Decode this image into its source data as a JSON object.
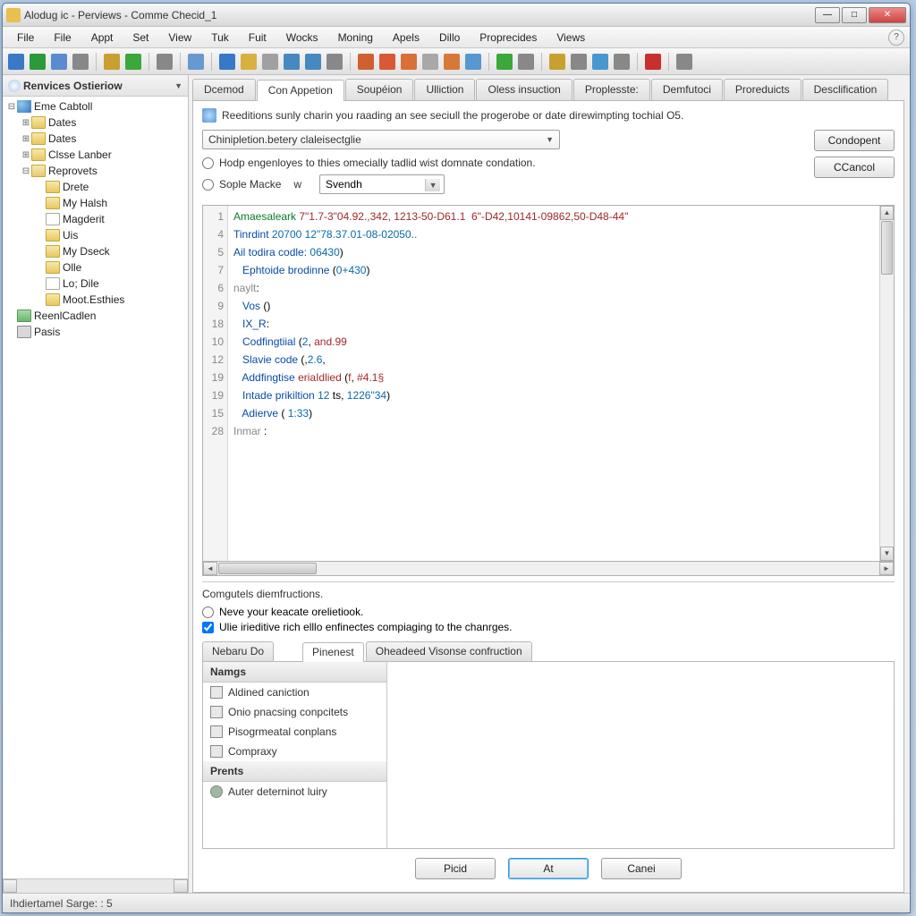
{
  "window": {
    "title": "Alodug ic - Perviews - Comme Checid_1"
  },
  "menus": [
    "File",
    "File",
    "Appt",
    "Set",
    "View",
    "Tuk",
    "Fuit",
    "Wocks",
    "Moning",
    "Apels",
    "Dillo",
    "Proprecides",
    "Views"
  ],
  "toolbar_colors": [
    "#3a78c8",
    "#2a9a3a",
    "#5a8ad0",
    "#888888",
    "",
    "#c8a030",
    "#3aa83a",
    "",
    "#888888",
    "",
    "#6898d0",
    "",
    "#3878c8",
    "#d8b040",
    "#a0a0a0",
    "#4888c0",
    "#4888c0",
    "#888888",
    "",
    "#d06030",
    "#d85838",
    "#d87038",
    "#a8a8a8",
    "#d87838",
    "#5898d0",
    "",
    "#3aa83a",
    "#888888",
    "",
    "#c8a030",
    "#888888",
    "#4898d0",
    "#888888",
    "",
    "#c83030",
    "",
    "#888888"
  ],
  "sidebar": {
    "title": "Renvices Ostieriow",
    "tree": [
      {
        "depth": 0,
        "tw": "⊟",
        "icon": "ic-globe",
        "label": "Eme Cabtoll"
      },
      {
        "depth": 1,
        "tw": "⊞",
        "icon": "ic-folder",
        "label": "Dates"
      },
      {
        "depth": 1,
        "tw": "⊞",
        "icon": "ic-folder",
        "label": "Dates"
      },
      {
        "depth": 1,
        "tw": "⊞",
        "icon": "ic-folder",
        "label": "Clsse Lanber"
      },
      {
        "depth": 1,
        "tw": "⊟",
        "icon": "ic-folder-open",
        "label": "Reprovets"
      },
      {
        "depth": 2,
        "tw": "",
        "icon": "ic-folder",
        "label": "Drete"
      },
      {
        "depth": 2,
        "tw": "",
        "icon": "ic-folder",
        "label": "My Halsh"
      },
      {
        "depth": 2,
        "tw": "",
        "icon": "ic-page",
        "label": "Magderit"
      },
      {
        "depth": 2,
        "tw": "",
        "icon": "ic-folder",
        "label": "Uis"
      },
      {
        "depth": 2,
        "tw": "",
        "icon": "ic-folder",
        "label": "My Dseck"
      },
      {
        "depth": 2,
        "tw": "",
        "icon": "ic-folder",
        "label": "Olle"
      },
      {
        "depth": 2,
        "tw": "",
        "icon": "ic-page",
        "label": "Lo; Dile"
      },
      {
        "depth": 2,
        "tw": "",
        "icon": "ic-folder",
        "label": "Moot.Esthies"
      },
      {
        "depth": 0,
        "tw": "",
        "icon": "ic-chart",
        "label": "ReenlCadlen"
      },
      {
        "depth": 0,
        "tw": "",
        "icon": "ic-gear",
        "label": "Pasis"
      }
    ]
  },
  "tabs": [
    "Dcemod",
    "Con Appetion",
    "Soupéion",
    "Ulliction",
    "Oless insuction",
    "Proplesste:",
    "Demfutoci",
    "Proreduicts",
    "Desclification"
  ],
  "active_tab": 1,
  "desc": "Reeditions sunly charin you raading an see seciull the progerobe or date direwimpting tochial O5.",
  "combo": "Chinipletion.betery claleisectglie",
  "radio1": "Hodp engenloyes to thies omecially tadlid wist domnate condation.",
  "radio2": "Sople Macke",
  "w_label": "w",
  "miniselect": "Svendh",
  "btn_condepent": "Condopent",
  "btn_cancel": "CCancol",
  "code": {
    "line_numbers": [
      "1",
      "4",
      "5",
      "7",
      "6",
      "9",
      "18",
      "10",
      "12",
      "19",
      "19",
      "15",
      "28"
    ],
    "lines": [
      [
        {
          "c": "tok-k",
          "t": "Amaesaleark"
        },
        {
          "c": "",
          "t": " "
        },
        {
          "c": "tok-r",
          "t": "7\"1.7-3\"04.92.,342, 1213-50-D61.1  6\"-D42,10141-09862,50-D48-44\""
        }
      ],
      [
        {
          "c": "tok-b",
          "t": "Tinrdint"
        },
        {
          "c": "",
          "t": " "
        },
        {
          "c": "tok-n",
          "t": "20700 12\"78.37.01-08-02050.."
        }
      ],
      [
        {
          "c": "tok-b",
          "t": "Ail todira codle:"
        },
        {
          "c": "",
          "t": " "
        },
        {
          "c": "tok-n",
          "t": "06430"
        },
        {
          "c": "",
          "t": ")"
        }
      ],
      [
        {
          "c": "",
          "t": "   "
        },
        {
          "c": "tok-b",
          "t": "Ephtoide brodinne"
        },
        {
          "c": "",
          "t": " ("
        },
        {
          "c": "tok-n",
          "t": "0+430"
        },
        {
          "c": "",
          "t": ")"
        }
      ],
      [
        {
          "c": "tok-g",
          "t": "naylt"
        },
        {
          "c": "",
          "t": ":"
        }
      ],
      [
        {
          "c": "",
          "t": "   "
        },
        {
          "c": "tok-b",
          "t": "Vos"
        },
        {
          "c": "",
          "t": " ()"
        }
      ],
      [
        {
          "c": "",
          "t": "   "
        },
        {
          "c": "tok-b",
          "t": "IX_R"
        },
        {
          "c": "",
          "t": ":"
        }
      ],
      [
        {
          "c": "",
          "t": "   "
        },
        {
          "c": "tok-b",
          "t": "Codfingtiial"
        },
        {
          "c": "",
          "t": " ("
        },
        {
          "c": "tok-n",
          "t": "2"
        },
        {
          "c": "",
          "t": ", "
        },
        {
          "c": "tok-r",
          "t": "and.99"
        }
      ],
      [
        {
          "c": "",
          "t": "   "
        },
        {
          "c": "tok-b",
          "t": "Slavie code"
        },
        {
          "c": "",
          "t": " (,"
        },
        {
          "c": "tok-n",
          "t": "2.6"
        },
        {
          "c": "",
          "t": ","
        }
      ],
      [
        {
          "c": "",
          "t": "   "
        },
        {
          "c": "tok-b",
          "t": "Addfingtise "
        },
        {
          "c": "tok-r",
          "t": "eriaIdlied"
        },
        {
          "c": "",
          "t": " ("
        },
        {
          "c": "tok-r",
          "t": "f"
        },
        {
          "c": "",
          "t": ", "
        },
        {
          "c": "tok-r",
          "t": "#4.1§"
        }
      ],
      [
        {
          "c": "",
          "t": "   "
        },
        {
          "c": "tok-b",
          "t": "Intade prikiltion"
        },
        {
          "c": "",
          "t": " "
        },
        {
          "c": "tok-n",
          "t": "12"
        },
        {
          "c": "",
          "t": " ts, "
        },
        {
          "c": "tok-n",
          "t": "1226\"34"
        },
        {
          "c": "",
          "t": ")"
        }
      ],
      [
        {
          "c": "",
          "t": "   "
        },
        {
          "c": "tok-b",
          "t": "Adierve"
        },
        {
          "c": "",
          "t": " ( "
        },
        {
          "c": "tok-n",
          "t": "1:33"
        },
        {
          "c": "",
          "t": ")"
        }
      ],
      [
        {
          "c": "tok-g",
          "t": "Inmar "
        },
        {
          "c": "",
          "t": ":"
        }
      ]
    ]
  },
  "lower": {
    "section": "Comgutels diemfructions.",
    "radio": "Neve your keacate orelietiook.",
    "check": "Ulie irieditive rich elllo enfinectes compiaging to the chanrges.",
    "tabs_left": "Nebaru Do",
    "tabs": [
      "Pinenest",
      "Oheadeed Visonse confruction"
    ],
    "panel": {
      "head1": "Namgs",
      "items": [
        "Aldined caniction",
        "Onio pnacsing conpcitets",
        "Pisogrmeatal conplans",
        "Compraxy"
      ],
      "head2": "Prents",
      "items2": [
        "Auter deterninot luiry"
      ]
    }
  },
  "bottom": {
    "read": "Picid",
    "at": "At",
    "cane": "Canei"
  },
  "status": "Ihdiertamel Sarge: : 5"
}
